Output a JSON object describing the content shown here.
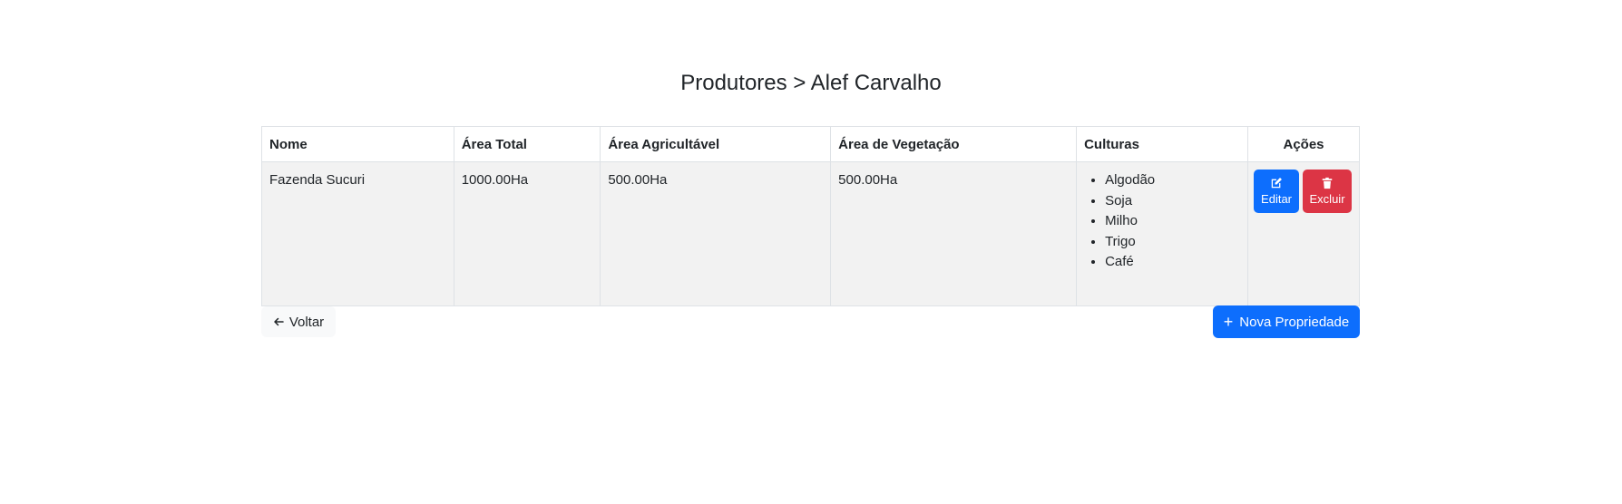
{
  "header": {
    "breadcrumb_parent": "Produtores",
    "breadcrumb_separator": ">",
    "breadcrumb_current": "Alef Carvalho"
  },
  "table": {
    "columns": [
      "Nome",
      "Área Total",
      "Área Agricultável",
      "Área de Vegetação",
      "Culturas",
      "Ações"
    ],
    "rows": [
      {
        "nome": "Fazenda Sucuri",
        "area_total": "1000.00Ha",
        "area_agricultavel": "500.00Ha",
        "area_vegetacao": "500.00Ha",
        "culturas": [
          "Algodão",
          "Soja",
          "Milho",
          "Trigo",
          "Café"
        ],
        "edit_label": "Editar",
        "delete_label": "Excluir"
      }
    ]
  },
  "footer": {
    "back_label": "Voltar",
    "new_label": "Nova Propriedade"
  },
  "icons": {
    "edit": "edit-icon",
    "delete": "trash-icon",
    "back": "arrow-left-icon",
    "add": "plus-icon"
  },
  "colors": {
    "primary": "#0d6efd",
    "danger": "#dc3545",
    "row_bg": "#f2f2f2",
    "back_bg": "#f8f9fa"
  }
}
